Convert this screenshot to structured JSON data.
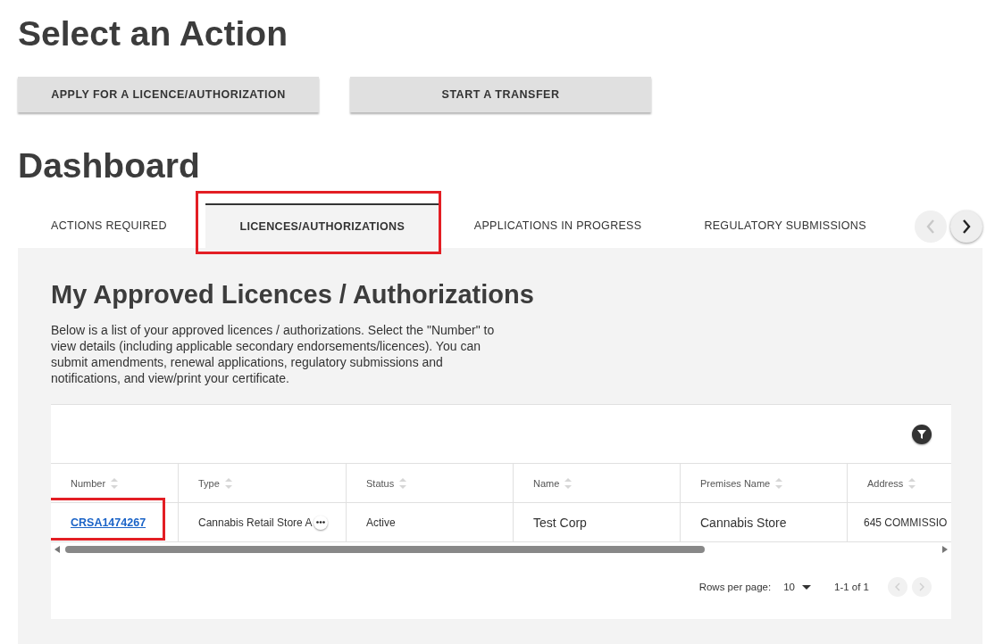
{
  "action_section": {
    "title": "Select an Action",
    "buttons": [
      "APPLY FOR A LICENCE/AUTHORIZATION",
      "START A TRANSFER"
    ]
  },
  "dashboard": {
    "title": "Dashboard",
    "tabs": [
      {
        "label": "ACTIONS REQUIRED",
        "selected": false,
        "highlighted": false
      },
      {
        "label": "LICENCES/AUTHORIZATIONS",
        "selected": true,
        "highlighted": true
      },
      {
        "label": "APPLICATIONS IN PROGRESS",
        "selected": false,
        "highlighted": false
      },
      {
        "label": "REGULATORY SUBMISSIONS",
        "selected": false,
        "highlighted": false
      }
    ],
    "tab_scroll": {
      "prev_disabled": true,
      "next_disabled": false
    },
    "panel": {
      "title": "My Approved Licences / Authorizations",
      "description": "Below is a list of your approved licences / authorizations. Select the \"Number\" to view details (including applicable secondary endorsements/licences). You can submit amendments, renewal applications, regulatory submissions and notifications, and view/print your certificate.",
      "table": {
        "columns": [
          "Number",
          "Type",
          "Status",
          "Name",
          "Premises Name",
          "Address"
        ],
        "rows": [
          {
            "cells": [
              {
                "text": "CRSA1474267",
                "kind": "link",
                "highlighted": true
              },
              {
                "text": "Cannabis Retail Store A",
                "kind": "truncated"
              },
              {
                "text": "Active",
                "kind": "text"
              },
              {
                "text": "Test Corp",
                "kind": "large"
              },
              {
                "text": "Cannabis Store",
                "kind": "large"
              },
              {
                "text": "645 COMMISSIO",
                "kind": "text"
              }
            ]
          }
        ]
      },
      "pagination": {
        "rows_label": "Rows per page:",
        "rows_value": "10",
        "range": "1-1 of 1",
        "prev_disabled": true,
        "next_disabled": true
      }
    }
  }
}
